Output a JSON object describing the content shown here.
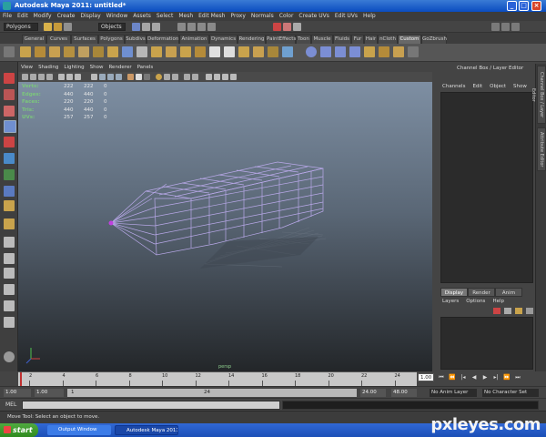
{
  "window": {
    "title": "Autodesk Maya 2011: untitled*",
    "min_label": "_",
    "max_label": "□",
    "close_label": "×"
  },
  "menubar": [
    "File",
    "Edit",
    "Modify",
    "Create",
    "Display",
    "Window",
    "Assets",
    "Select",
    "Mesh",
    "Edit Mesh",
    "Proxy",
    "Normals",
    "Color",
    "Create UVs",
    "Edit UVs",
    "Help"
  ],
  "statusline": {
    "menu_set": "Polygons",
    "selection_mode": "Objects"
  },
  "shelf_tabs": [
    "General",
    "Curves",
    "Surfaces",
    "Polygons",
    "Subdivs",
    "Deformation",
    "Animation",
    "Dynamics",
    "Rendering",
    "PaintEffects",
    "Toon",
    "Muscle",
    "Fluids",
    "Fur",
    "Hair",
    "nCloth",
    "Custom",
    "GoZbrush"
  ],
  "shelf_active_tab": "Custom",
  "viewport_menu": [
    "View",
    "Shading",
    "Lighting",
    "Show",
    "Renderer",
    "Panels"
  ],
  "hud": {
    "rows": [
      {
        "label": "Verts:",
        "values": [
          "222",
          "222",
          "0"
        ]
      },
      {
        "label": "Edges:",
        "values": [
          "440",
          "440",
          "0"
        ]
      },
      {
        "label": "Faces:",
        "values": [
          "220",
          "220",
          "0"
        ]
      },
      {
        "label": "Tris:",
        "values": [
          "440",
          "440",
          "0"
        ]
      },
      {
        "label": "UVs:",
        "values": [
          "257",
          "257",
          "0"
        ]
      }
    ],
    "camera": "persp"
  },
  "channel_box": {
    "title": "Channel Box / Layer Editor",
    "menu": [
      "Channels",
      "Edit",
      "Object",
      "Show"
    ]
  },
  "layer_editor": {
    "tabs": [
      "Display",
      "Render",
      "Anim"
    ],
    "menu": [
      "Layers",
      "Options",
      "Help"
    ]
  },
  "side_tabs": [
    "Channel Box / Layer Editor",
    "Attribute Editor"
  ],
  "timeline": {
    "ticks": [
      "2",
      "4",
      "6",
      "8",
      "10",
      "12",
      "14",
      "16",
      "18",
      "20",
      "22",
      "24"
    ],
    "current_frame": "1.00"
  },
  "range": {
    "start": "1.00",
    "playback_start": "1.00",
    "range_start_field": "1",
    "range_end_field": "24",
    "playback_end": "24.00",
    "end": "48.00",
    "anim_layer": "No Anim Layer",
    "character_set": "No Character Set"
  },
  "mel": {
    "label": "MEL"
  },
  "helpline": {
    "text": "Move Tool: Select an object to move."
  },
  "taskbar": {
    "start": "start",
    "tasks": [
      "Output Window",
      "Autodesk Maya 2011..."
    ]
  },
  "watermark": "pxleyes.com",
  "colors": {
    "titlebar": "#0a4cc0",
    "viewport_top": "#7e8fa3",
    "viewport_bottom": "#232629",
    "wireframe": "#b8a8e8",
    "start_button": "#2f8a1f"
  }
}
